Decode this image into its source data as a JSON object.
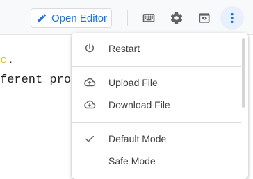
{
  "toolbar": {
    "open_editor_label": "Open Editor",
    "icons": [
      "pencil-icon",
      "keyboard-icon",
      "gear-icon",
      "preview-window-icon",
      "more-vertical-icon"
    ]
  },
  "code": {
    "line1_char": "c",
    "line1_rest": ".",
    "line2": "ferent pro"
  },
  "menu": {
    "restart": "Restart",
    "upload_file": "Upload File",
    "download_file": "Download File",
    "default_mode": "Default Mode",
    "safe_mode": "Safe Mode",
    "selected_mode": "Default Mode"
  },
  "colors": {
    "accent": "#1a73e8",
    "active_bg": "#e8f0fe",
    "icon": "#5f6368",
    "text": "#3c4043"
  }
}
